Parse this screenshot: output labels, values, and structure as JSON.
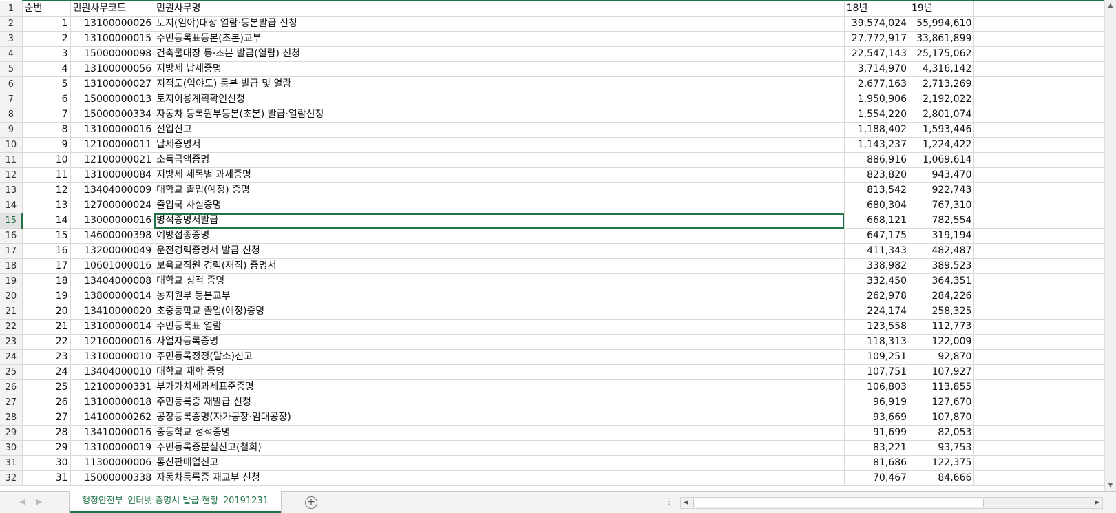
{
  "columns": {
    "seq": "순번",
    "code": "민원사무코드",
    "name": "민원사무명",
    "y18": "18년",
    "y19": "19년"
  },
  "rows": [
    {
      "row": "2",
      "seq": "1",
      "code": "13100000026",
      "name": "토지(임야)대장 열람·등본발급 신청",
      "y18": "39,574,024",
      "y19": "55,994,610"
    },
    {
      "row": "3",
      "seq": "2",
      "code": "13100000015",
      "name": "주민등록표등본(초본)교부",
      "y18": "27,772,917",
      "y19": "33,861,899"
    },
    {
      "row": "4",
      "seq": "3",
      "code": "15000000098",
      "name": "건축물대장 등·초본 발급(열람) 신청",
      "y18": "22,547,143",
      "y19": "25,175,062"
    },
    {
      "row": "5",
      "seq": "4",
      "code": "13100000056",
      "name": "지방세 납세증명",
      "y18": "3,714,970",
      "y19": "4,316,142"
    },
    {
      "row": "6",
      "seq": "5",
      "code": "13100000027",
      "name": "지적도(임야도) 등본 발급 및 열람",
      "y18": "2,677,163",
      "y19": "2,713,269"
    },
    {
      "row": "7",
      "seq": "6",
      "code": "15000000013",
      "name": "토지이용계획확인신청",
      "y18": "1,950,906",
      "y19": "2,192,022"
    },
    {
      "row": "8",
      "seq": "7",
      "code": "15000000334",
      "name": "자동차 등록원부등본(초본) 발급·열람신청",
      "y18": "1,554,220",
      "y19": "2,801,074"
    },
    {
      "row": "9",
      "seq": "8",
      "code": "13100000016",
      "name": "전입신고",
      "y18": "1,188,402",
      "y19": "1,593,446"
    },
    {
      "row": "10",
      "seq": "9",
      "code": "12100000011",
      "name": "납세증명서",
      "y18": "1,143,237",
      "y19": "1,224,422"
    },
    {
      "row": "11",
      "seq": "10",
      "code": "12100000021",
      "name": "소득금액증명",
      "y18": "886,916",
      "y19": "1,069,614"
    },
    {
      "row": "12",
      "seq": "11",
      "code": "13100000084",
      "name": "지방세 세목별 과세증명",
      "y18": "823,820",
      "y19": "943,470"
    },
    {
      "row": "13",
      "seq": "12",
      "code": "13404000009",
      "name": "대학교 졸업(예정) 증명",
      "y18": "813,542",
      "y19": "922,743"
    },
    {
      "row": "14",
      "seq": "13",
      "code": "12700000024",
      "name": "출입국 사실증명",
      "y18": "680,304",
      "y19": "767,310"
    },
    {
      "row": "15",
      "seq": "14",
      "code": "13000000016",
      "name": "병적증명서발급",
      "y18": "668,121",
      "y19": "782,554"
    },
    {
      "row": "16",
      "seq": "15",
      "code": "14600000398",
      "name": "예방접종증명",
      "y18": "647,175",
      "y19": "319,194"
    },
    {
      "row": "17",
      "seq": "16",
      "code": "13200000049",
      "name": "운전경력증명서 발급 신청",
      "y18": "411,343",
      "y19": "482,487"
    },
    {
      "row": "18",
      "seq": "17",
      "code": "10601000016",
      "name": "보육교직원 경력(재직) 증명서",
      "y18": "338,982",
      "y19": "389,523"
    },
    {
      "row": "19",
      "seq": "18",
      "code": "13404000008",
      "name": "대학교 성적 증명",
      "y18": "332,450",
      "y19": "364,351"
    },
    {
      "row": "20",
      "seq": "19",
      "code": "13800000014",
      "name": "농지원부 등본교부",
      "y18": "262,978",
      "y19": "284,226"
    },
    {
      "row": "21",
      "seq": "20",
      "code": "13410000020",
      "name": "초중등학교 졸업(예정)증명",
      "y18": "224,174",
      "y19": "258,325"
    },
    {
      "row": "22",
      "seq": "21",
      "code": "13100000014",
      "name": "주민등록표 열람",
      "y18": "123,558",
      "y19": "112,773"
    },
    {
      "row": "23",
      "seq": "22",
      "code": "12100000016",
      "name": "사업자등록증명",
      "y18": "118,313",
      "y19": "122,009"
    },
    {
      "row": "24",
      "seq": "23",
      "code": "13100000010",
      "name": "주민등록정정(말소)신고",
      "y18": "109,251",
      "y19": "92,870"
    },
    {
      "row": "25",
      "seq": "24",
      "code": "13404000010",
      "name": "대학교 재학 증명",
      "y18": "107,751",
      "y19": "107,927"
    },
    {
      "row": "26",
      "seq": "25",
      "code": "12100000331",
      "name": "부가가치세과세표준증명",
      "y18": "106,803",
      "y19": "113,855"
    },
    {
      "row": "27",
      "seq": "26",
      "code": "13100000018",
      "name": "주민등록증 재발급 신청",
      "y18": "96,919",
      "y19": "127,670"
    },
    {
      "row": "28",
      "seq": "27",
      "code": "14100000262",
      "name": "공장등록증명(자가공장·임대공장)",
      "y18": "93,669",
      "y19": "107,870"
    },
    {
      "row": "29",
      "seq": "28",
      "code": "13410000016",
      "name": "중등학교 성적증명",
      "y18": "91,699",
      "y19": "82,053"
    },
    {
      "row": "30",
      "seq": "29",
      "code": "13100000019",
      "name": "주민등록증분실신고(철회)",
      "y18": "83,221",
      "y19": "93,753"
    },
    {
      "row": "31",
      "seq": "30",
      "code": "11300000006",
      "name": "통신판매업신고",
      "y18": "81,686",
      "y19": "122,375"
    },
    {
      "row": "32",
      "seq": "31",
      "code": "15000000338",
      "name": "자동차등록증 재교부 신청",
      "y18": "70,467",
      "y19": "84,666"
    }
  ],
  "selected_row": "15",
  "sheet_tab": "행정안전부_인터넷 증명서 발급 현황_20191231",
  "icons": {
    "add_sheet": "plus-circle-icon",
    "prev": "triangle-left-icon",
    "next": "triangle-right-icon"
  },
  "colors": {
    "accent": "#217346"
  }
}
